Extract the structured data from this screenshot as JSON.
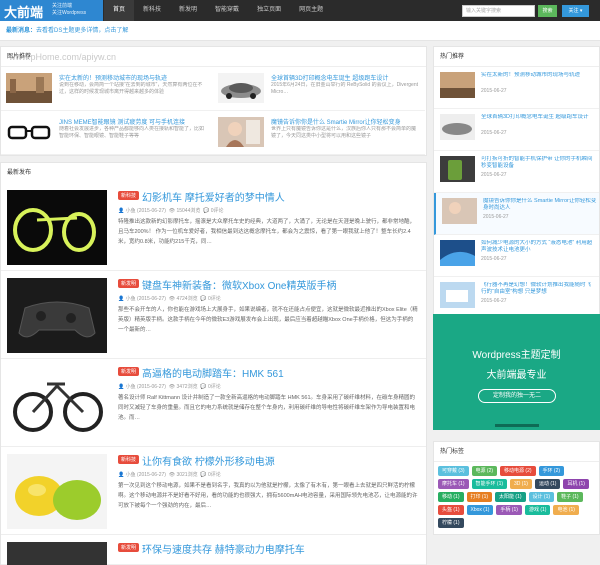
{
  "header": {
    "logo": "大前端",
    "logo_sub1": "关注前端",
    "logo_sub2": "关注Wordpress",
    "nav": [
      "首页",
      "新科技",
      "新发明",
      "智能穿戴",
      "独立页面",
      "网页主题"
    ],
    "search_placeholder": "输入关键字搜索",
    "search_btn": "搜索",
    "follow_btn": "关注 ▾"
  },
  "notice": {
    "label": "最新消息：",
    "text": "去看看DS主题更多详情，点击了解"
  },
  "featured": {
    "heading": "图片推荐",
    "watermark": "www.pHome.com/apiyw.cn",
    "items": [
      {
        "title": "实在太新的！预测移动城市的现场与轨迹",
        "desc": "说到在移动，会简简一个站接“在去到的城市”，天然算有两位在不过，这样的时候发现城市离开得越来越多的体验"
      },
      {
        "title": "全球首辆3D打印概念电车诞生 超级跑车设计",
        "desc": "2015年6月24日，在旧金山举行的 ReBySolid 的会议上，Divergent Micro…"
      },
      {
        "title": "JINS MEME智能眼镜 测试疲劳度 可与手机连接",
        "desc": "随着社会发展进步，各种产品都能够向人类在接轨和智能了，比如智能环保、智能眼镜、智能鞋子等等"
      },
      {
        "title": "魔镜告诉你你是什么 Smartie Mirror让你轻松变身",
        "desc": "世界上只有魔镜告诉你这是什么，汉族后你人只有那不会简单的魔镜了，今天同这类中小型将可以用和这些镜子"
      }
    ]
  },
  "posts": {
    "heading": "最新发布",
    "badge_new": "新科技",
    "badge_inv": "新发明",
    "items": [
      {
        "badge": "新科技",
        "title": "幻影机车 摩托爱好者的梦中情人",
        "author": "小鱼",
        "date": "(2015-06-27)",
        "views": "15044浏览",
        "comments": "0评论",
        "excerpt": "特隆推出这款新的幻影摩托车，摇滚是大众摩托车史的经典，大道两了，大涌了，无论是在天涯是晚上驶行，都非常地酷，且马车200%！ 作为一位机车爱好者，我相信最到达这概念摩托车，都会为之震惊，看了第一眼我就上他了！整车长约2.4米，宽约0.8米，功能约215千克，同…"
      },
      {
        "badge": "新发明",
        "title": "键盘车神新装备：微软Xbox One精英版手柄",
        "author": "小鱼",
        "date": "(2015-06-27)",
        "views": "4724浏览",
        "comments": "0评论",
        "excerpt": "那些不会开车的人，你也能在游戏场上大展身手，如果说编者，就不在还能占点便宜，这就是微软最近推出的Xbox Elite（精英版）精英版手柄。这款手柄在今年的微软E3游戏展发布会上出现，最后应当着超越瞄Xbox One手柄价格，但这为手柄的一个最新的…"
      },
      {
        "badge": "新发明",
        "title": "高逼格的电动脚踏车：HMK 561",
        "author": "小鱼",
        "date": "(2015-06-27)",
        "views": "3472浏览",
        "comments": "0评论",
        "excerpt": "著名设计师 Ralf Kittmann 设计并制造了一款全新高逼格的电动脚踏车 HMK 561。车身采用了碳纤维材料，在碳车身精圆的同时又减轻了车身的重量。而且它的电力系统就是储存在整个车身内，利用碳纤维的导电性将碳纤维车架作为导电装置和电池。而…"
      },
      {
        "badge": "新科技",
        "title": "让你有食欲 柠檬外形移动电源",
        "author": "小鱼",
        "date": "(2015-06-27)",
        "views": "3021浏览",
        "comments": "0评论",
        "excerpt": "第一次见到这个移动电源，如果不是看到名字，我真的以为他就是柠檬，太像了有木有，第一眼看上去就是四只鲜活的柠檬啊。这个移动电源并不是好看不好用，看的功能的也很强大，拥有5600mAH电池容量，采用国际领先电池芯，让电源能的许可放下被每个一个强劲的内在，最后…"
      },
      {
        "badge": "新发明",
        "title": "环保与速度共存 赫特豪动力电摩托车",
        "author": "",
        "date": "",
        "views": "",
        "comments": "",
        "excerpt": ""
      }
    ]
  },
  "sidebar": {
    "hot_heading": "热门推荐",
    "hot": [
      {
        "title": "实在太新的！预测移动城市的现场与轨迹",
        "date": "2015-06-27"
      },
      {
        "title": "全球首辆3D打印概念电车诞生 超级跑车设计",
        "date": "2015-06-27"
      },
      {
        "title": "可打拆可折的智能手机保护带 让你的手机瞬间秒变智能设备",
        "date": "2015-06-27"
      },
      {
        "title": "魔镜告诉你你是什么 Smartie Mirror让你轻松变身时尚达人",
        "date": "2015-06-27"
      },
      {
        "title": "如何减少电源的大小的方式 “液态电池” 利用超声波技术让电池更小",
        "date": "2015-06-27"
      },
      {
        "title": "飞行器不再是幻想！微软计划推出我能随时飞行的“自由室”构想 只是梦想",
        "date": "2015-06-27"
      }
    ],
    "ad": {
      "line1": "Wordpress主题定制",
      "line2": "大前端最专业",
      "button": "定制我的独一无二"
    },
    "tags_heading": "热门标签",
    "tags": [
      "可穿戴 (3)",
      "电源 (2)",
      "移动电源 (2)",
      "手环 (2)",
      "摩托车 (1)",
      "智能手环 (1)",
      "3D (1)",
      "运动 (1)",
      "耳机 (1)",
      "移动 (1)",
      "打印 (1)",
      "太阳能 (1)",
      "设计 (1)",
      "鞋子 (1)",
      "头盔 (1)",
      "Xbox (1)",
      "手柄 (1)",
      "游戏 (1)",
      "电池 (1)",
      "柠檬 (1)"
    ]
  },
  "colors": {
    "brand": "#2e87d1",
    "accent": "#3498db",
    "badge": "#e74c3c",
    "ad": "#1aa885"
  }
}
